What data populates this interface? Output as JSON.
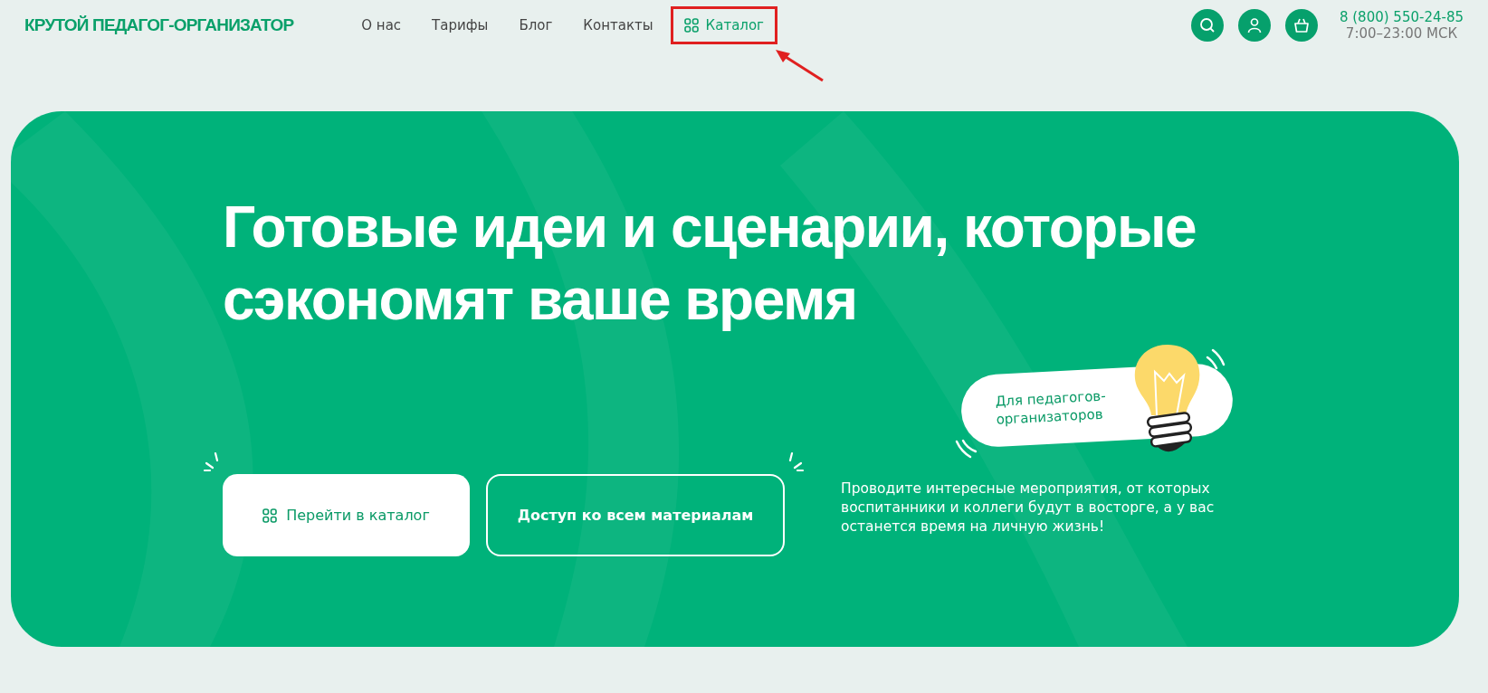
{
  "header": {
    "logo": "КРУТОЙ ПЕДАГОГ-ОРГАНИЗАТОР",
    "nav": [
      {
        "label": "О нас",
        "kind": "link",
        "highlighted": false
      },
      {
        "label": "Тарифы",
        "kind": "link",
        "highlighted": false
      },
      {
        "label": "Блог",
        "kind": "link",
        "highlighted": false
      },
      {
        "label": "Контакты",
        "kind": "link",
        "highlighted": false
      },
      {
        "label": "Каталог",
        "kind": "catalog",
        "highlighted": true
      }
    ],
    "phone": "8 (800) 550-24-85",
    "hours": "7:00–23:00 МСК"
  },
  "hero": {
    "title_lines": [
      "Готовые идеи и сценарии, которые",
      "сэкономят ваше время"
    ],
    "badge": "Для педагогов-организаторов",
    "buttons": [
      {
        "label": "Перейти в каталог",
        "kind": "primary"
      },
      {
        "label": "Доступ ко всем материалам",
        "kind": "outline"
      }
    ],
    "description": "Проводите интересные мероприятия, от которых воспитанники и коллеги будут в восторге, а у вас останется время на личную жизнь!"
  }
}
